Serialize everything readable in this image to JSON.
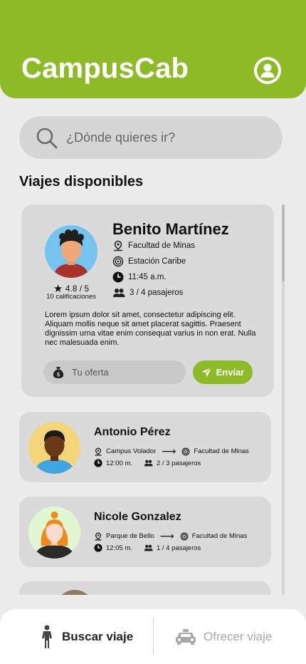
{
  "app": {
    "title": "CampusCab"
  },
  "search": {
    "placeholder": "¿Dónde quieres ir?"
  },
  "section": {
    "title": "Viajes disponibles"
  },
  "featured_trip": {
    "driver": "Benito Martínez",
    "rating": "4.8 / 5",
    "rating_count": "10 calificaciones",
    "origin": "Facultad de Minas",
    "destination": "Estación Caribe",
    "time": "11:45 a.m.",
    "passengers": "3 / 4 pasajeros",
    "description": "Lorem ipsum dolor sit amet, consectetur adipiscing elit. Aliquam mollis neque sit amet placerat sagittis. Praesent dignissim urna vitae enim consequat varius in non erat. Nulla nec malesuada enim.",
    "offer_placeholder": "Tu oferta",
    "send_label": "Envíar"
  },
  "trips": [
    {
      "driver": "Antonio Pérez",
      "origin": "Campus Volador",
      "destination": "Facultad de Minas",
      "time": "12:00 m.",
      "passengers": "2 / 3 pasajeros"
    },
    {
      "driver": "Nicole Gonzalez",
      "origin": "Parque de Bello",
      "destination": "Facultad de Minas",
      "time": "12:05 m.",
      "passengers": "1 / 4 pasajeros"
    }
  ],
  "symbols": {
    "arrow": "⟶",
    "star": "★"
  },
  "nav": {
    "search_label": "Buscar viaje",
    "offer_label": "Ofrecer viaje"
  },
  "colors": {
    "brand": "#8dbb27",
    "card": "#dadada",
    "background": "#ececec"
  },
  "icons": [
    "search-icon",
    "user-icon",
    "location-pin-icon",
    "target-icon",
    "clock-icon",
    "passengers-icon",
    "money-bag-icon",
    "send-icon",
    "person-icon",
    "car-icon",
    "star-icon"
  ]
}
